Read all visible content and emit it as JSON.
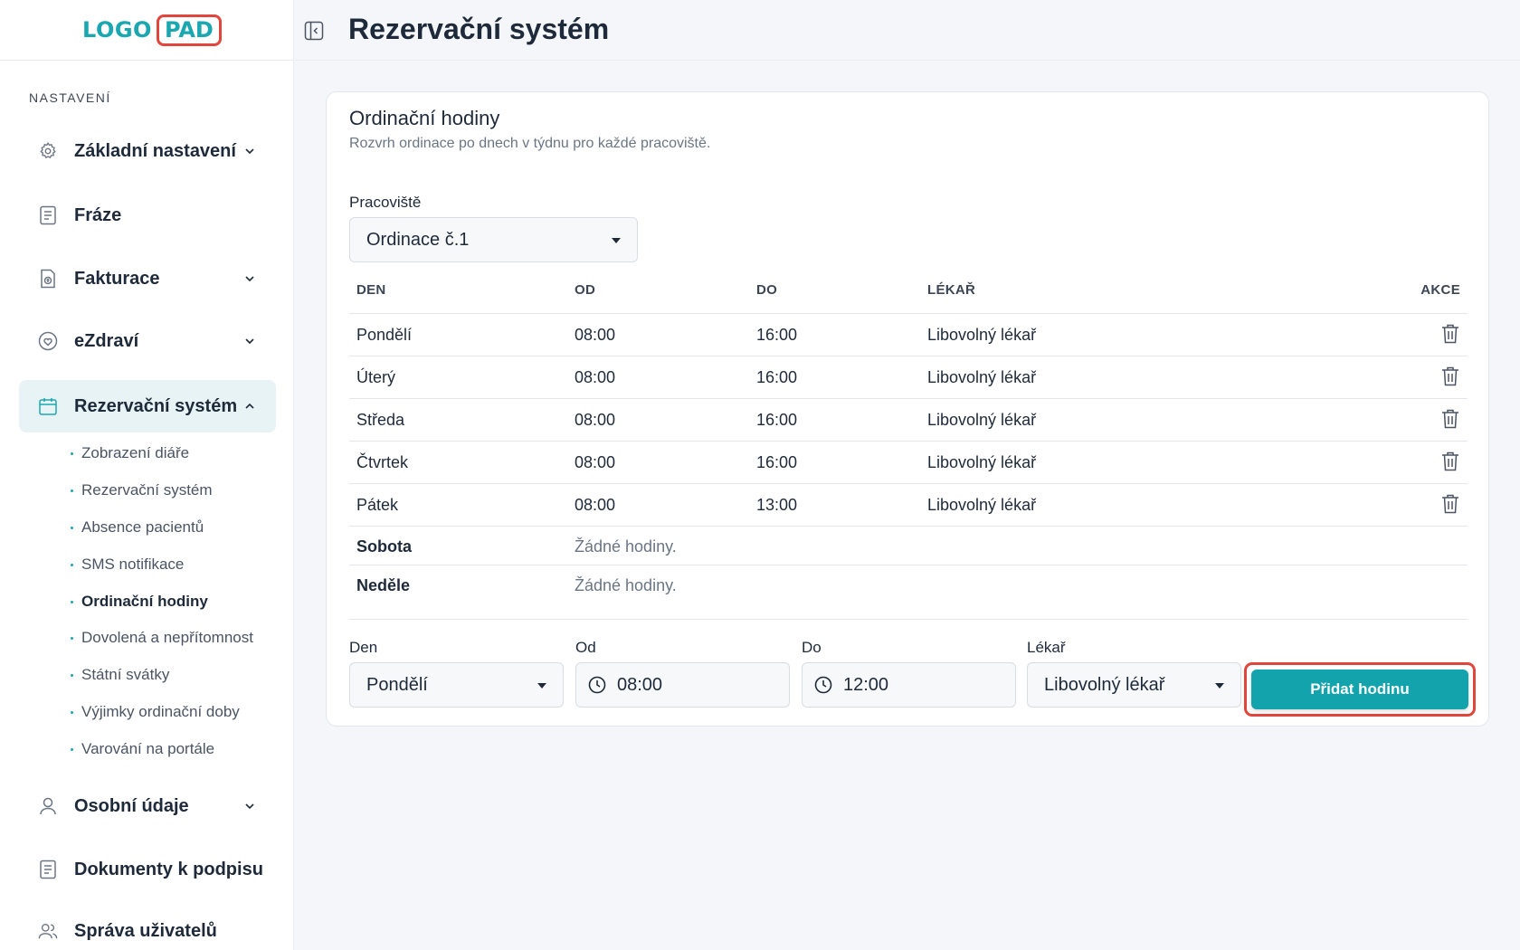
{
  "logo": {
    "left": "LOGO",
    "right": "PAD"
  },
  "sidebar": {
    "section_title": "NASTAVENÍ",
    "items": [
      {
        "label": "Základní nastavení",
        "icon": "gear-icon",
        "chevron": "down"
      },
      {
        "label": "Fráze",
        "icon": "document-icon"
      },
      {
        "label": "Fakturace",
        "icon": "invoice-icon",
        "chevron": "down"
      },
      {
        "label": "eZdraví",
        "icon": "heart-icon",
        "chevron": "down"
      },
      {
        "label": "Rezervační systém",
        "icon": "calendar-icon",
        "chevron": "up",
        "active": true
      },
      {
        "label": "Osobní údaje",
        "icon": "user-icon",
        "chevron": "down"
      },
      {
        "label": "Dokumenty k podpisu",
        "icon": "document-icon"
      },
      {
        "label": "Správa uživatelů",
        "icon": "users-icon"
      }
    ],
    "subitems": [
      "Zobrazení diáře",
      "Rezervační systém",
      "Absence pacientů",
      "SMS notifikace",
      "Ordinační hodiny",
      "Dovolená a nepřítomnost",
      "Státní svátky",
      "Výjimky ordinační doby",
      "Varování na portále"
    ],
    "active_subitem": "Ordinační hodiny"
  },
  "header": {
    "title": "Rezervační systém"
  },
  "card": {
    "title": "Ordinační hodiny",
    "subtitle": "Rozvrh ordinace po dnech v týdnu pro každé pracoviště.",
    "workplace_label": "Pracoviště",
    "workplace_value": "Ordinace č.1",
    "table": {
      "headers": [
        "DEN",
        "OD",
        "DO",
        "LÉKAŘ",
        "AKCE"
      ],
      "rows": [
        {
          "day": "Pondělí",
          "from": "08:00",
          "to": "16:00",
          "doctor": "Libovolný lékař"
        },
        {
          "day": "Úterý",
          "from": "08:00",
          "to": "16:00",
          "doctor": "Libovolný lékař"
        },
        {
          "day": "Středa",
          "from": "08:00",
          "to": "16:00",
          "doctor": "Libovolný lékař"
        },
        {
          "day": "Čtvrtek",
          "from": "08:00",
          "to": "16:00",
          "doctor": "Libovolný lékař"
        },
        {
          "day": "Pátek",
          "from": "08:00",
          "to": "13:00",
          "doctor": "Libovolný lékař"
        }
      ],
      "empty_rows": [
        {
          "day": "Sobota",
          "note": "Žádné hodiny."
        },
        {
          "day": "Neděle",
          "note": "Žádné hodiny."
        }
      ]
    },
    "form": {
      "day_label": "Den",
      "day_value": "Pondělí",
      "from_label": "Od",
      "from_value": "08:00",
      "to_label": "Do",
      "to_value": "12:00",
      "doctor_label": "Lékař",
      "doctor_value": "Libovolný lékař",
      "add_button": "Přidat hodinu"
    }
  },
  "colors": {
    "accent": "#12a3ad",
    "highlight": "#e2453c",
    "active_nav_bg": "#e8f3f6"
  }
}
